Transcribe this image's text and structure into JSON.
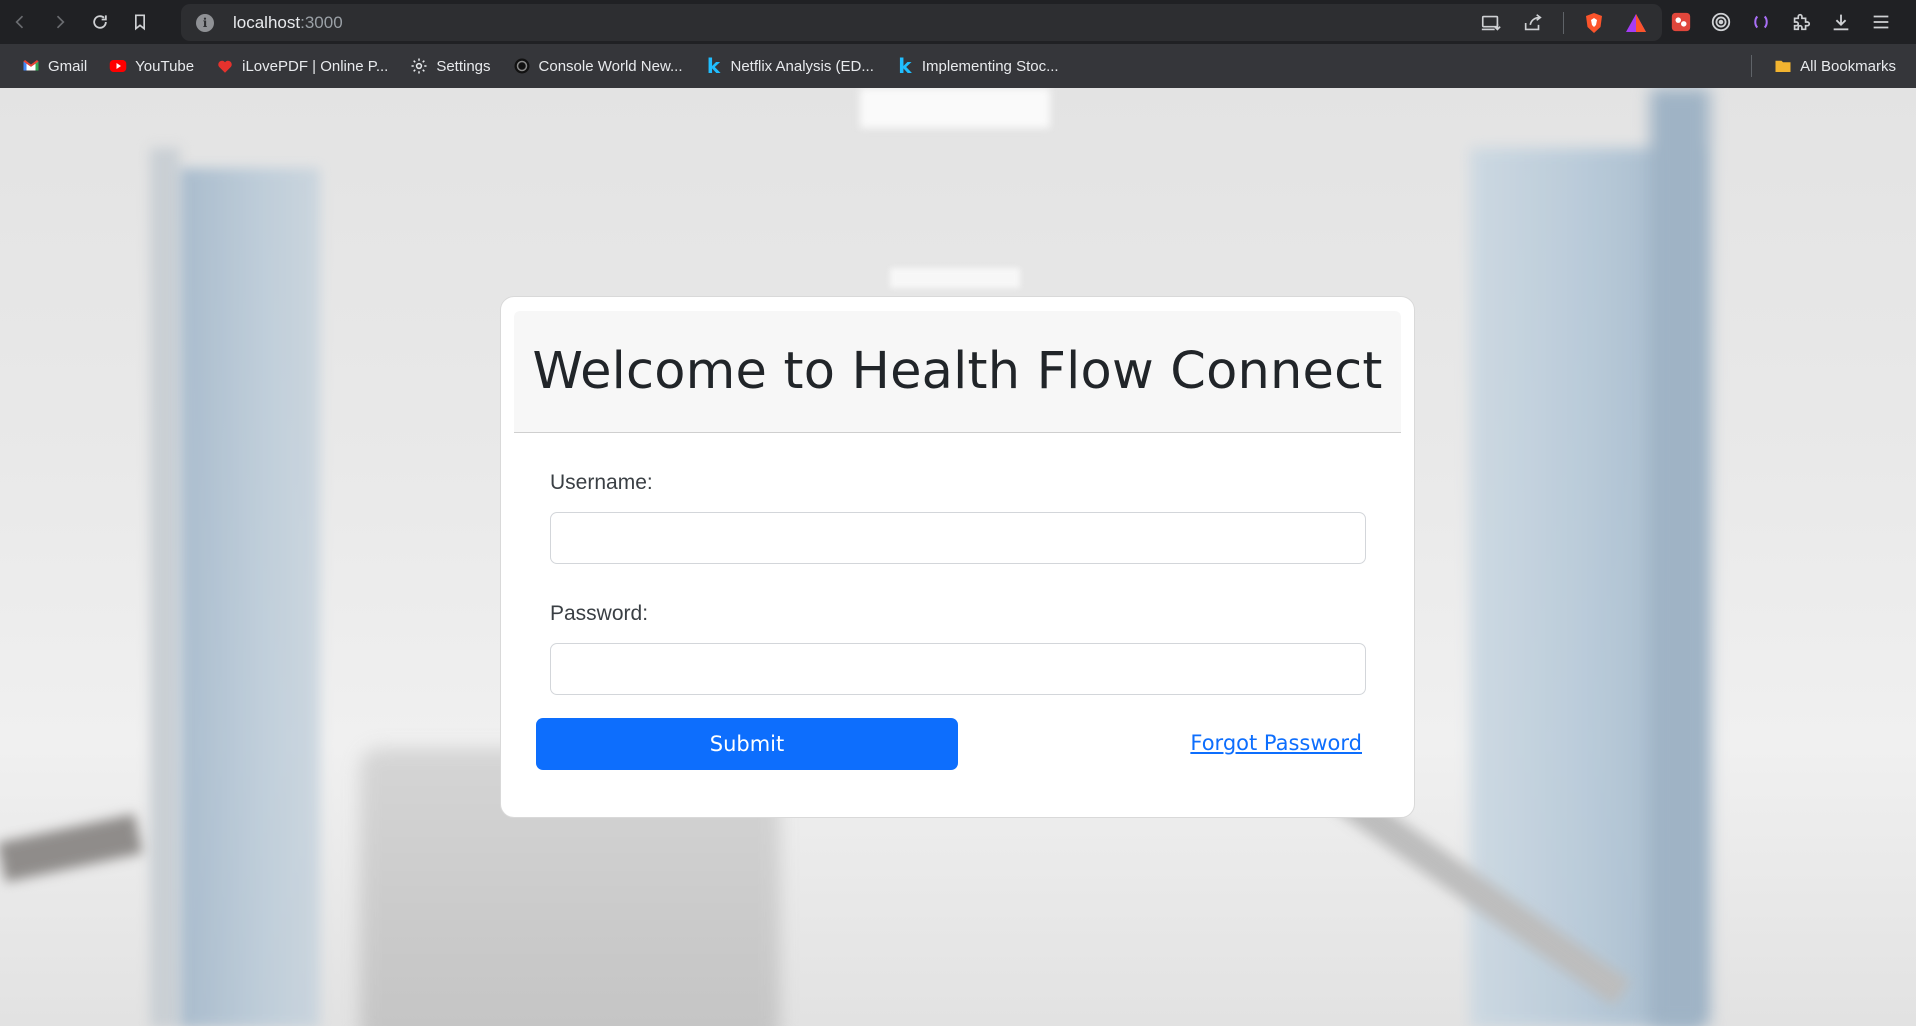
{
  "browser": {
    "url_host": "localhost",
    "url_port": ":3000",
    "bookmarks": [
      {
        "label": "Gmail",
        "icon": "gmail-icon"
      },
      {
        "label": "YouTube",
        "icon": "youtube-icon"
      },
      {
        "label": "iLovePDF | Online P...",
        "icon": "ilovepdf-icon"
      },
      {
        "label": "Settings",
        "icon": "gear-icon"
      },
      {
        "label": "Console World New...",
        "icon": "console-world-icon"
      },
      {
        "label": "Netflix Analysis (ED...",
        "icon": "kaggle-icon"
      },
      {
        "label": "Implementing Stoc...",
        "icon": "kaggle-icon"
      }
    ],
    "all_bookmarks_label": "All Bookmarks"
  },
  "login": {
    "title": "Welcome to Health Flow Connect",
    "username_label": "Username:",
    "username_value": "",
    "password_label": "Password:",
    "password_value": "",
    "submit_label": "Submit",
    "forgot_label": "Forgot Password"
  },
  "colors": {
    "primary": "#0d6efd",
    "chrome_bg": "#202124",
    "bookmarks_bg": "#35363a"
  }
}
